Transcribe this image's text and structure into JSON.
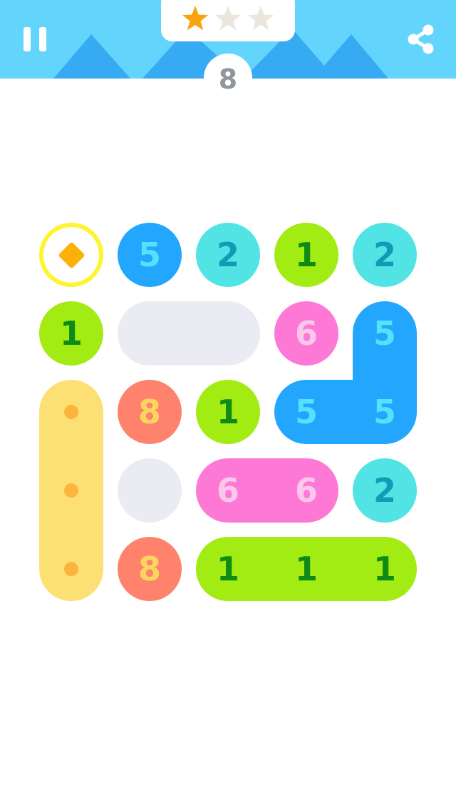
{
  "level": {
    "number": "8"
  },
  "stars": {
    "total": 3,
    "earned": 1,
    "earned_color": "#f7a40f",
    "empty_color": "#ece6de"
  },
  "header": {
    "background": "#63d5fc",
    "mountain_color": "#37aaf4"
  },
  "icons": {
    "pause": "pause-icon",
    "share": "share-icon",
    "goal": "diamond-icon"
  },
  "colors": {
    "blue": {
      "fill": "#23a6fd",
      "text": "#56e1fb"
    },
    "cyan": {
      "fill": "#52e4e5",
      "text": "#139bb6"
    },
    "green": {
      "fill": "#a2eb13",
      "text": "#0d8b14"
    },
    "pink": {
      "fill": "#fe78d6",
      "text": "#fbc8ec"
    },
    "coral": {
      "fill": "#fe826c",
      "text": "#fcd560"
    },
    "empty": {
      "fill": "#ebebf3"
    },
    "yellow": {
      "fill": "#fde074",
      "dot": "#fdb43c"
    },
    "goal": {
      "ring": "#fdf432",
      "diamond": "#fdb007"
    }
  },
  "board": {
    "columns": 5,
    "rows": 5,
    "pieces": [
      {
        "kind": "goal",
        "cells": [
          [
            0,
            0
          ]
        ]
      },
      {
        "kind": "number",
        "color": "blue",
        "cells": [
          [
            0,
            1
          ]
        ],
        "numbers": [
          "5"
        ]
      },
      {
        "kind": "number",
        "color": "cyan",
        "cells": [
          [
            0,
            2
          ]
        ],
        "numbers": [
          "2"
        ]
      },
      {
        "kind": "number",
        "color": "green",
        "cells": [
          [
            0,
            3
          ]
        ],
        "numbers": [
          "1"
        ]
      },
      {
        "kind": "number",
        "color": "cyan",
        "cells": [
          [
            0,
            4
          ]
        ],
        "numbers": [
          "2"
        ]
      },
      {
        "kind": "number",
        "color": "green",
        "cells": [
          [
            1,
            0
          ]
        ],
        "numbers": [
          "1"
        ]
      },
      {
        "kind": "empty",
        "cells": [
          [
            1,
            1
          ],
          [
            1,
            2
          ]
        ]
      },
      {
        "kind": "number",
        "color": "pink",
        "cells": [
          [
            1,
            3
          ]
        ],
        "numbers": [
          "6"
        ]
      },
      {
        "kind": "number",
        "color": "blue",
        "cells": [
          [
            1,
            4
          ],
          [
            2,
            3
          ],
          [
            2,
            4
          ]
        ],
        "numbers": [
          "5",
          "5",
          "5"
        ],
        "shape": "L"
      },
      {
        "kind": "dots",
        "color": "yellow",
        "cells": [
          [
            2,
            0
          ],
          [
            3,
            0
          ],
          [
            4,
            0
          ]
        ]
      },
      {
        "kind": "number",
        "color": "coral",
        "cells": [
          [
            2,
            1
          ]
        ],
        "numbers": [
          "8"
        ]
      },
      {
        "kind": "number",
        "color": "green",
        "cells": [
          [
            2,
            2
          ]
        ],
        "numbers": [
          "1"
        ]
      },
      {
        "kind": "empty",
        "cells": [
          [
            3,
            1
          ]
        ]
      },
      {
        "kind": "number",
        "color": "pink",
        "cells": [
          [
            3,
            2
          ],
          [
            3,
            3
          ]
        ],
        "numbers": [
          "6",
          "6"
        ]
      },
      {
        "kind": "number",
        "color": "cyan",
        "cells": [
          [
            3,
            4
          ]
        ],
        "numbers": [
          "2"
        ]
      },
      {
        "kind": "number",
        "color": "coral",
        "cells": [
          [
            4,
            1
          ]
        ],
        "numbers": [
          "8"
        ]
      },
      {
        "kind": "number",
        "color": "green",
        "cells": [
          [
            4,
            2
          ],
          [
            4,
            3
          ],
          [
            4,
            4
          ]
        ],
        "numbers": [
          "1",
          "1",
          "1"
        ]
      }
    ]
  }
}
